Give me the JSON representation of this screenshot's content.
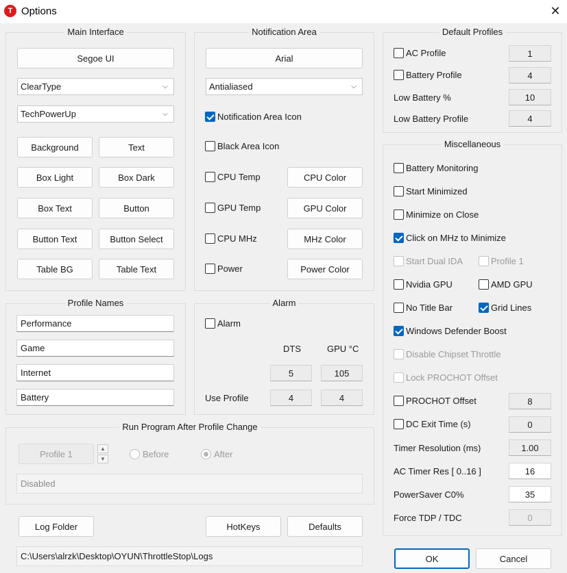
{
  "window": {
    "title": "Options",
    "app_icon_letter": "T",
    "close_glyph": "✕"
  },
  "main_interface": {
    "title": "Main Interface",
    "font_button": "Segoe UI",
    "smoothing_value": "ClearType",
    "theme_value": "TechPowerUp",
    "buttons": [
      "Background",
      "Text",
      "Box Light",
      "Box Dark",
      "Box Text",
      "Button",
      "Button Text",
      "Button Select",
      "Table BG",
      "Table Text"
    ]
  },
  "notification": {
    "title": "Notification Area",
    "font_button": "Arial",
    "smoothing_value": "Antialiased",
    "icon_label": "Notification Area Icon",
    "black_label": "Black Area Icon",
    "cpu_temp_label": "CPU Temp",
    "cpu_color": "CPU Color",
    "gpu_temp_label": "GPU Temp",
    "gpu_color": "GPU Color",
    "cpu_mhz_label": "CPU MHz",
    "mhz_color": "MHz Color",
    "power_label": "Power",
    "power_color": "Power Color"
  },
  "default_profiles": {
    "title": "Default Profiles",
    "ac_label": "AC Profile",
    "ac_value": "1",
    "battery_label": "Battery Profile",
    "battery_value": "4",
    "low_pct_label": "Low Battery %",
    "low_pct_value": "10",
    "low_profile_label": "Low Battery Profile",
    "low_profile_value": "4"
  },
  "misc": {
    "title": "Miscellaneous",
    "battery_monitoring": "Battery Monitoring",
    "start_minimized": "Start Minimized",
    "minimize_on_close": "Minimize on Close",
    "click_mhz": "Click on MHz to Minimize",
    "start_dual_ida": "Start Dual IDA",
    "profile1": "Profile 1",
    "nvidia": "Nvidia GPU",
    "amd": "AMD GPU",
    "no_title": "No Title Bar",
    "grid_lines": "Grid Lines",
    "defender": "Windows Defender Boost",
    "disable_chipset": "Disable Chipset Throttle",
    "lock_prochot": "Lock PROCHOT Offset",
    "prochot_offset": "PROCHOT Offset",
    "prochot_value": "8",
    "dc_exit": "DC Exit Time (s)",
    "dc_exit_value": "0",
    "timer_res": "Timer Resolution (ms)",
    "timer_res_value": "1.00",
    "ac_timer": "AC Timer Res [ 0..16 ]",
    "ac_timer_value": "16",
    "powersaver": "PowerSaver C0%",
    "powersaver_value": "35",
    "force_tdp": "Force TDP / TDC",
    "force_tdp_value": "0"
  },
  "profile_names": {
    "title": "Profile Names",
    "names": [
      "Performance",
      "Game",
      "Internet",
      "Battery"
    ]
  },
  "alarm": {
    "title": "Alarm",
    "alarm_label": "Alarm",
    "dts_header": "DTS",
    "gpu_header": "GPU °C",
    "dts_value": "5",
    "gpu_value": "105",
    "use_profile_label": "Use Profile",
    "use_dts": "4",
    "use_gpu": "4"
  },
  "run_program": {
    "title": "Run Program After Profile Change",
    "profile_button": "Profile 1",
    "before_label": "Before",
    "after_label": "After",
    "command_text": "Disabled",
    "spin_up": "▲",
    "spin_down": "▼"
  },
  "footer": {
    "log_folder": "Log Folder",
    "hotkeys": "HotKeys",
    "defaults": "Defaults",
    "log_path": "C:\\Users\\alrzk\\Desktop\\OYUN\\ThrottleStop\\Logs",
    "ok": "OK",
    "cancel": "Cancel"
  },
  "icons": {
    "chevron": "⌄"
  }
}
